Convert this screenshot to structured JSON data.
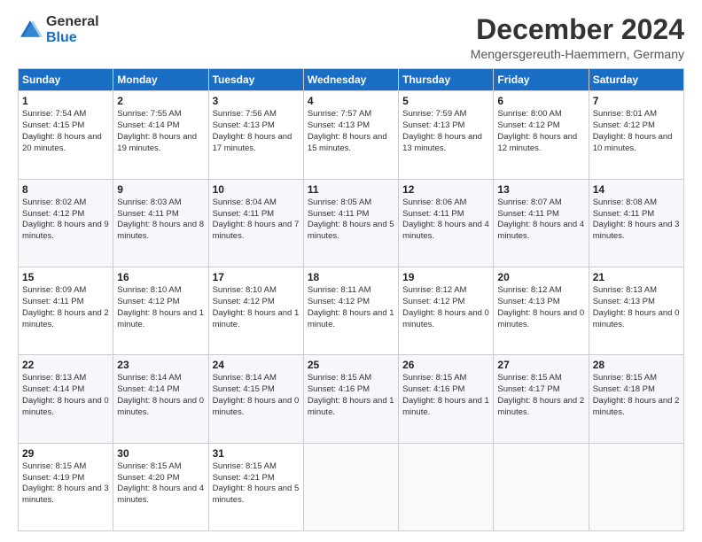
{
  "header": {
    "logo_general": "General",
    "logo_blue": "Blue",
    "title": "December 2024",
    "location": "Mengersgereuth-Haemmern, Germany"
  },
  "days_of_week": [
    "Sunday",
    "Monday",
    "Tuesday",
    "Wednesday",
    "Thursday",
    "Friday",
    "Saturday"
  ],
  "weeks": [
    [
      {
        "day": 1,
        "sunrise": "7:54 AM",
        "sunset": "4:15 PM",
        "daylight": "8 hours and 20 minutes."
      },
      {
        "day": 2,
        "sunrise": "7:55 AM",
        "sunset": "4:14 PM",
        "daylight": "8 hours and 19 minutes."
      },
      {
        "day": 3,
        "sunrise": "7:56 AM",
        "sunset": "4:13 PM",
        "daylight": "8 hours and 17 minutes."
      },
      {
        "day": 4,
        "sunrise": "7:57 AM",
        "sunset": "4:13 PM",
        "daylight": "8 hours and 15 minutes."
      },
      {
        "day": 5,
        "sunrise": "7:59 AM",
        "sunset": "4:13 PM",
        "daylight": "8 hours and 13 minutes."
      },
      {
        "day": 6,
        "sunrise": "8:00 AM",
        "sunset": "4:12 PM",
        "daylight": "8 hours and 12 minutes."
      },
      {
        "day": 7,
        "sunrise": "8:01 AM",
        "sunset": "4:12 PM",
        "daylight": "8 hours and 10 minutes."
      }
    ],
    [
      {
        "day": 8,
        "sunrise": "8:02 AM",
        "sunset": "4:12 PM",
        "daylight": "8 hours and 9 minutes."
      },
      {
        "day": 9,
        "sunrise": "8:03 AM",
        "sunset": "4:11 PM",
        "daylight": "8 hours and 8 minutes."
      },
      {
        "day": 10,
        "sunrise": "8:04 AM",
        "sunset": "4:11 PM",
        "daylight": "8 hours and 7 minutes."
      },
      {
        "day": 11,
        "sunrise": "8:05 AM",
        "sunset": "4:11 PM",
        "daylight": "8 hours and 5 minutes."
      },
      {
        "day": 12,
        "sunrise": "8:06 AM",
        "sunset": "4:11 PM",
        "daylight": "8 hours and 4 minutes."
      },
      {
        "day": 13,
        "sunrise": "8:07 AM",
        "sunset": "4:11 PM",
        "daylight": "8 hours and 4 minutes."
      },
      {
        "day": 14,
        "sunrise": "8:08 AM",
        "sunset": "4:11 PM",
        "daylight": "8 hours and 3 minutes."
      }
    ],
    [
      {
        "day": 15,
        "sunrise": "8:09 AM",
        "sunset": "4:11 PM",
        "daylight": "8 hours and 2 minutes."
      },
      {
        "day": 16,
        "sunrise": "8:10 AM",
        "sunset": "4:12 PM",
        "daylight": "8 hours and 1 minute."
      },
      {
        "day": 17,
        "sunrise": "8:10 AM",
        "sunset": "4:12 PM",
        "daylight": "8 hours and 1 minute."
      },
      {
        "day": 18,
        "sunrise": "8:11 AM",
        "sunset": "4:12 PM",
        "daylight": "8 hours and 1 minute."
      },
      {
        "day": 19,
        "sunrise": "8:12 AM",
        "sunset": "4:12 PM",
        "daylight": "8 hours and 0 minutes."
      },
      {
        "day": 20,
        "sunrise": "8:12 AM",
        "sunset": "4:13 PM",
        "daylight": "8 hours and 0 minutes."
      },
      {
        "day": 21,
        "sunrise": "8:13 AM",
        "sunset": "4:13 PM",
        "daylight": "8 hours and 0 minutes."
      }
    ],
    [
      {
        "day": 22,
        "sunrise": "8:13 AM",
        "sunset": "4:14 PM",
        "daylight": "8 hours and 0 minutes."
      },
      {
        "day": 23,
        "sunrise": "8:14 AM",
        "sunset": "4:14 PM",
        "daylight": "8 hours and 0 minutes."
      },
      {
        "day": 24,
        "sunrise": "8:14 AM",
        "sunset": "4:15 PM",
        "daylight": "8 hours and 0 minutes."
      },
      {
        "day": 25,
        "sunrise": "8:15 AM",
        "sunset": "4:16 PM",
        "daylight": "8 hours and 1 minute."
      },
      {
        "day": 26,
        "sunrise": "8:15 AM",
        "sunset": "4:16 PM",
        "daylight": "8 hours and 1 minute."
      },
      {
        "day": 27,
        "sunrise": "8:15 AM",
        "sunset": "4:17 PM",
        "daylight": "8 hours and 2 minutes."
      },
      {
        "day": 28,
        "sunrise": "8:15 AM",
        "sunset": "4:18 PM",
        "daylight": "8 hours and 2 minutes."
      }
    ],
    [
      {
        "day": 29,
        "sunrise": "8:15 AM",
        "sunset": "4:19 PM",
        "daylight": "8 hours and 3 minutes."
      },
      {
        "day": 30,
        "sunrise": "8:15 AM",
        "sunset": "4:20 PM",
        "daylight": "8 hours and 4 minutes."
      },
      {
        "day": 31,
        "sunrise": "8:15 AM",
        "sunset": "4:21 PM",
        "daylight": "8 hours and 5 minutes."
      },
      null,
      null,
      null,
      null
    ]
  ]
}
